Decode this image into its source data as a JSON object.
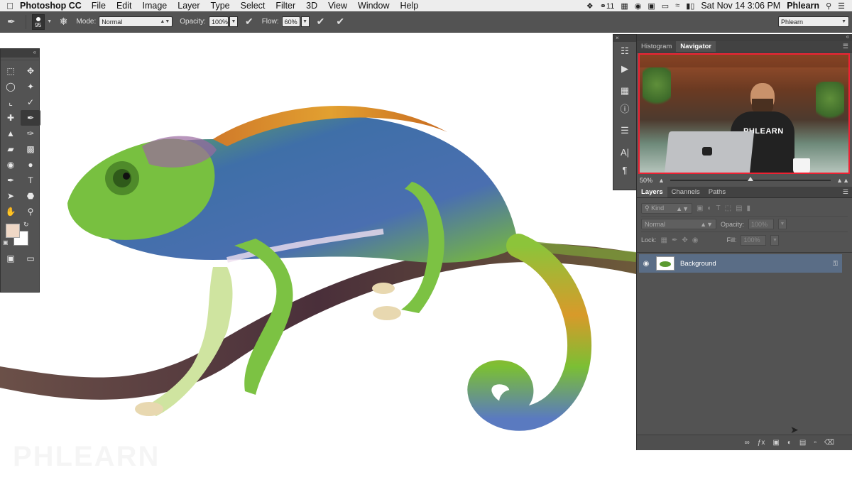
{
  "menubar": {
    "app_name": "Photoshop CC",
    "menus": [
      "File",
      "Edit",
      "Image",
      "Layer",
      "Type",
      "Select",
      "Filter",
      "3D",
      "View",
      "Window",
      "Help"
    ],
    "badge_count": "11",
    "datetime": "Sat Nov 14  3:06 PM",
    "user": "Phlearn"
  },
  "options": {
    "brush_size": "95",
    "mode_label": "Mode:",
    "mode_value": "Normal",
    "opacity_label": "Opacity:",
    "opacity_value": "100%",
    "flow_label": "Flow:",
    "flow_value": "60%",
    "workspace": "Phlearn"
  },
  "tools": {
    "foreground_color": "#efd8c6",
    "background_color": "#ffffff"
  },
  "navigator": {
    "tabs": [
      "Histogram",
      "Navigator"
    ],
    "active_tab": "Navigator",
    "shirt_logo": "PHLEARN",
    "zoom": "50%"
  },
  "layers": {
    "tabs": [
      "Layers",
      "Channels",
      "Paths"
    ],
    "active_tab": "Layers",
    "filter_kind": "Kind",
    "blend_mode": "Normal",
    "opacity_label": "Opacity:",
    "opacity_value": "100%",
    "lock_label": "Lock:",
    "fill_label": "Fill:",
    "fill_value": "100%",
    "items": [
      {
        "name": "Background",
        "visible": true,
        "locked": true,
        "selected": true
      }
    ]
  },
  "canvas": {
    "watermark": "PHLEARN"
  },
  "colors": {
    "panel_bg": "#535353",
    "layer_selected": "#5a6d86"
  }
}
